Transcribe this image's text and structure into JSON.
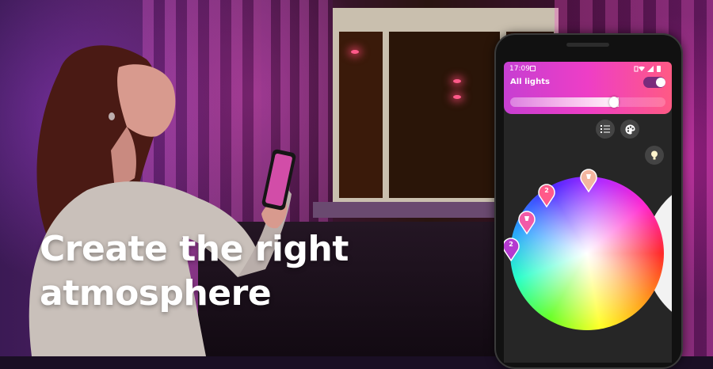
{
  "headline": {
    "line1": "Create the right",
    "line2": "atmosphere"
  },
  "phone": {
    "status_bar": {
      "time": "17:09",
      "icons": [
        "notification-icon",
        "vibrate-icon",
        "wifi-icon",
        "signal-icon",
        "battery-icon"
      ]
    },
    "light_group": {
      "label": "All lights",
      "on": true,
      "brightness": 0.68
    },
    "mode_buttons": [
      "list-icon",
      "palette-icon",
      "color-wheel-icon",
      "white-bulb-icon"
    ],
    "active_mode": "color-wheel-icon",
    "color_pins": [
      {
        "label": "",
        "icon": "lamp-icon",
        "color": "#f3b6a0"
      },
      {
        "label": "2",
        "icon": "",
        "color": "#ff5a8a"
      },
      {
        "label": "",
        "icon": "lamp-icon",
        "color": "#f25aa8"
      },
      {
        "label": "2",
        "icon": "",
        "color": "#b43ad0"
      }
    ]
  },
  "colors": {
    "header_gradient_start": "#c63fd2",
    "header_gradient_end": "#ff5a84",
    "screen_background": "#262626"
  }
}
